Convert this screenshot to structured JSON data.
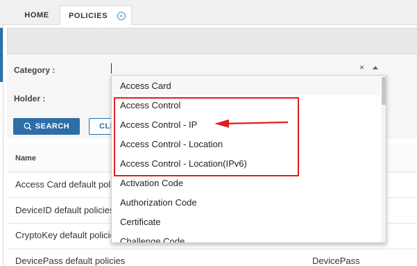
{
  "tabs": [
    {
      "label": "HOME"
    },
    {
      "label": "POLICIES"
    }
  ],
  "tab_close_glyph": "×",
  "form": {
    "category_label": "Category :",
    "holder_label": "Holder :",
    "clear_glyph": "×",
    "search_label": "SEARCH",
    "clear_label": "CLEAR"
  },
  "table": {
    "name_header": "Name",
    "rows": [
      {
        "name": "Access Card default policies",
        "col2": ""
      },
      {
        "name": "DeviceID default policies",
        "col2": ""
      },
      {
        "name": "CryptoKey default policies",
        "col2": ""
      },
      {
        "name": "DevicePass default policies",
        "col2": "DevicePass"
      }
    ]
  },
  "dropdown": {
    "options": [
      "Access Card",
      "Access Control",
      "Access Control - IP",
      "Access Control - Location",
      "Access Control - Location(IPv6)",
      "Activation Code",
      "Authorization Code",
      "Certificate",
      "Challenge Code"
    ]
  },
  "colors": {
    "accent": "#2c6ea5",
    "annotation": "#dd1e1e",
    "tab_close": "#3a8fd0"
  },
  "icons": {
    "search": "search-icon",
    "close": "close-icon",
    "arrow_up": "chevron-up-icon"
  }
}
